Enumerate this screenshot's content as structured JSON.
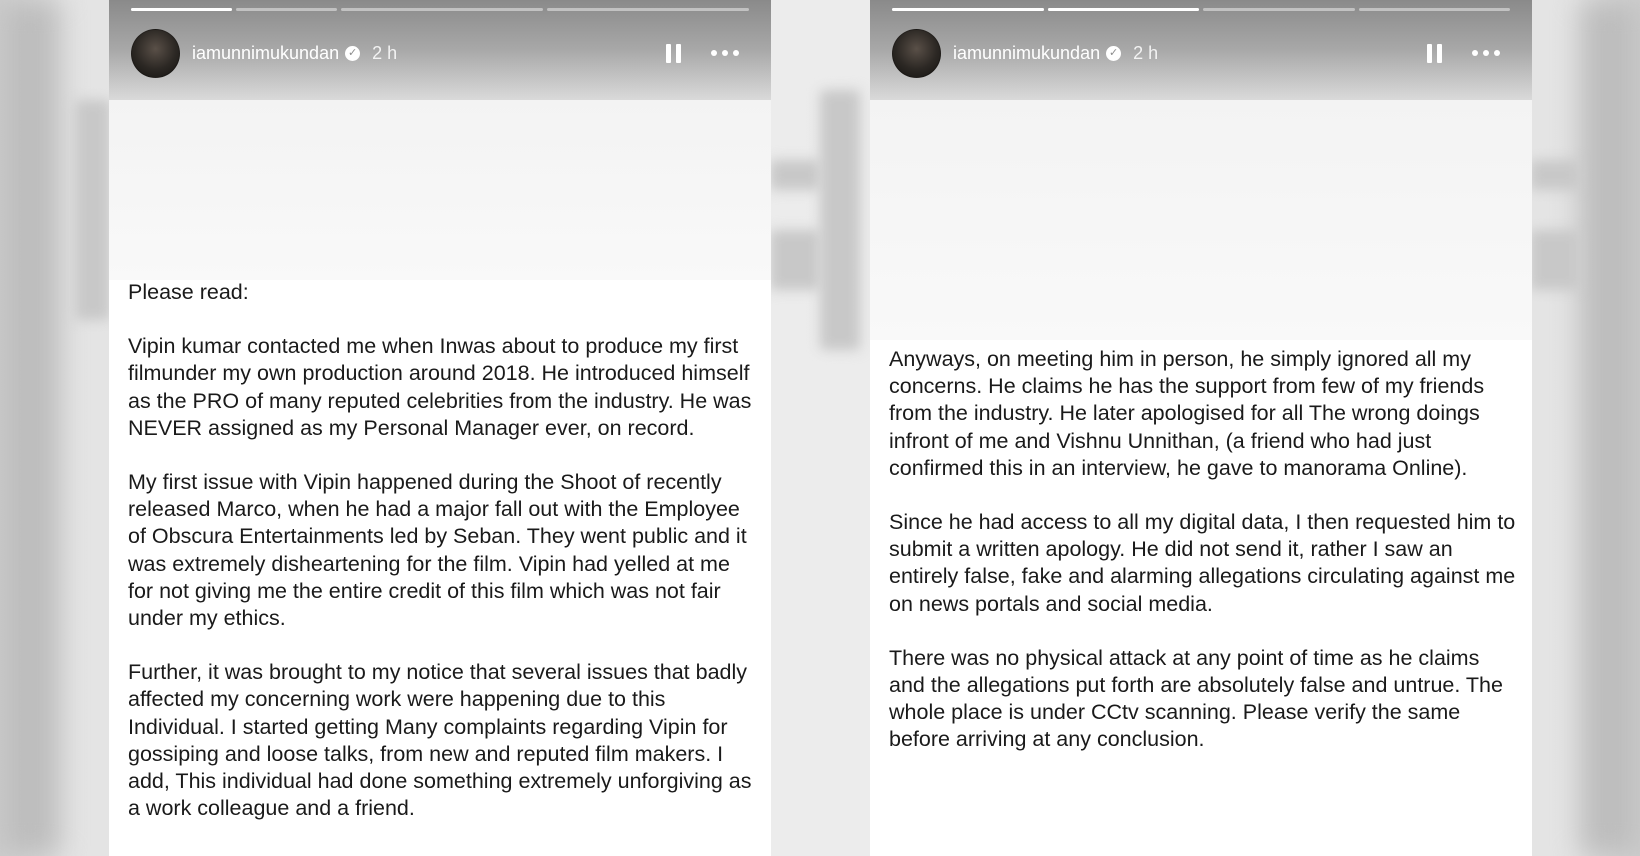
{
  "stories": [
    {
      "username": "iamunnimukundan",
      "time": "2 h",
      "progress": [
        1,
        0,
        0,
        0
      ],
      "paragraphs": [
        "Please read:",
        "Vipin kumar contacted me when Inwas about to produce my first filmunder my own production around 2018. He introduced himself as the PRO of many reputed celebrities from the industry. He was NEVER assigned as my Personal Manager ever, on record.",
        "My first issue with Vipin happened during the Shoot of recently released Marco, when he had a major fall out with the Employee of Obscura Entertainments led by Seban. They went public and it was extremely disheartening for the film. Vipin had yelled at me for not giving me the entire credit of this film which was not fair under my ethics.",
        "Further, it was brought to my notice that several issues that badly affected my concerning work were happening due to this Individual. I started getting Many complaints regarding Vipin for gossiping and loose talks, from new and reputed film makers. I add, This individual had done something extremely unforgiving as a work colleague and a friend."
      ]
    },
    {
      "username": "iamunnimukundan",
      "time": "2 h",
      "progress": [
        1,
        1,
        0,
        0
      ],
      "paragraphs": [
        "Anyways, on meeting him in person, he simply ignored all my concerns. He claims he has the support from few of my friends from the industry. He later apologised for all The wrong doings infront of me and Vishnu Unnithan, (a friend who had just confirmed this in an interview, he gave to manorama Online).",
        "Since he had access to all my digital data, I then requested him to submit a written apology. He did not send it, rather I saw an entirely false, fake and alarming allegations circulating against me on news portals and social media.",
        "There was no physical attack at any point of time as he claims and the allegations put forth are absolutely false and untrue. The whole place is under CCtv scanning. Please verify the same before arriving at any conclusion."
      ]
    }
  ]
}
